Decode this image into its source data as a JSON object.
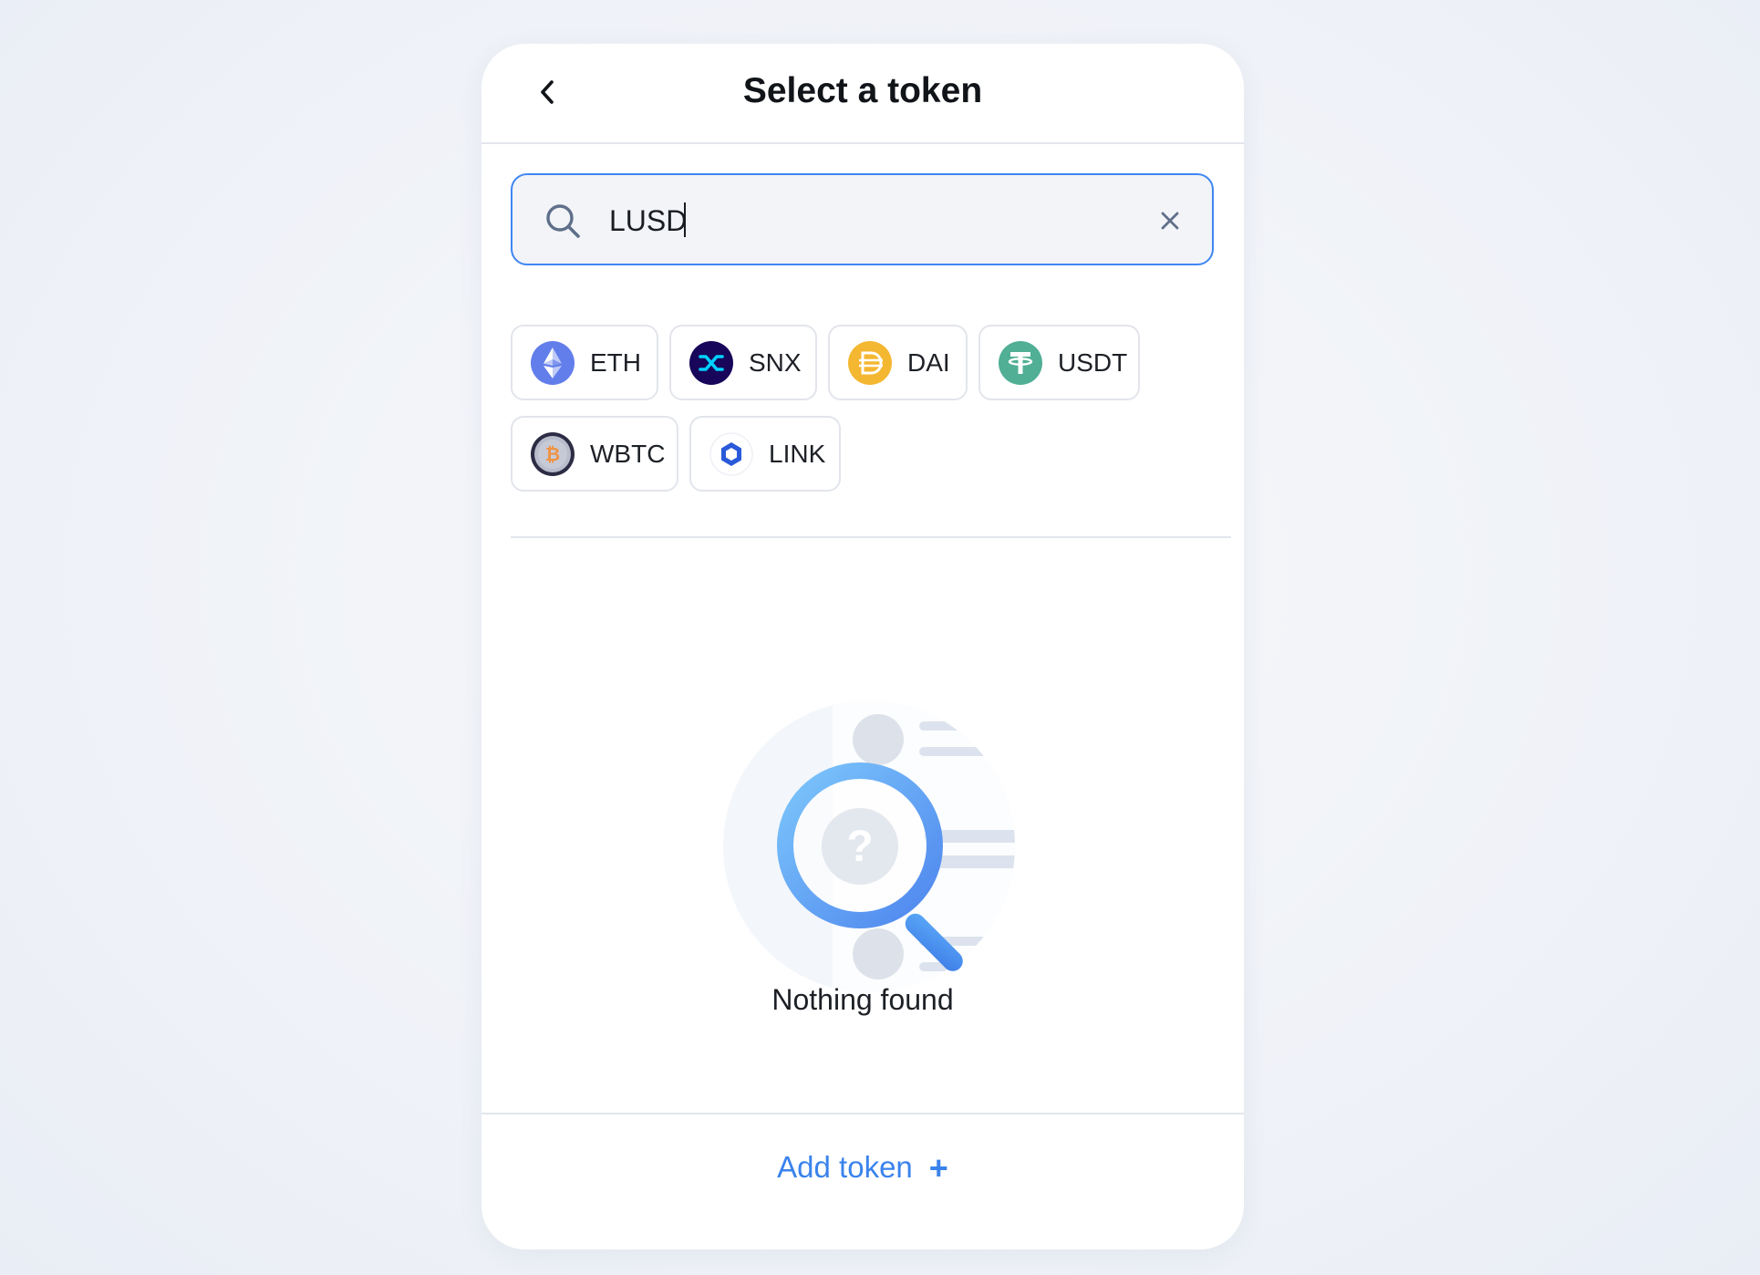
{
  "header": {
    "title": "Select a token"
  },
  "search": {
    "value": "LUSD",
    "placeholder": ""
  },
  "tokens": [
    {
      "symbol": "ETH",
      "icon": "ethereum-icon",
      "color": "#627eea"
    },
    {
      "symbol": "SNX",
      "icon": "synthetix-icon",
      "color": "#170659"
    },
    {
      "symbol": "DAI",
      "icon": "dai-icon",
      "color": "#f4b731"
    },
    {
      "symbol": "USDT",
      "icon": "tether-icon",
      "color": "#50af95"
    },
    {
      "symbol": "WBTC",
      "icon": "wrapped-bitcoin-icon",
      "color": "#f09242"
    },
    {
      "symbol": "LINK",
      "icon": "chainlink-icon",
      "color": "#2a5ada"
    }
  ],
  "empty_state": {
    "icon": "magnifier-question-icon",
    "message": "Nothing found"
  },
  "footer": {
    "add_token_label": "Add token",
    "add_icon": "plus-icon"
  },
  "colors": {
    "accent": "#3a83ec",
    "border": "#e2e5eb"
  }
}
